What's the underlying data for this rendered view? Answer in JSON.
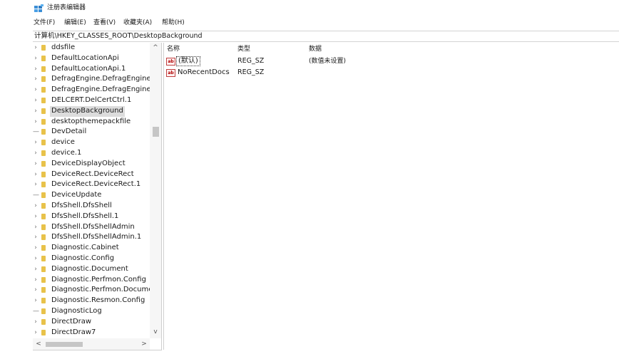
{
  "window": {
    "title": "注册表编辑器",
    "icon": "registry-editor-icon"
  },
  "menu": [
    "文件(F)",
    "编辑(E)",
    "查看(V)",
    "收藏夹(A)",
    "帮助(H)"
  ],
  "address": "计算机\\HKEY_CLASSES_ROOT\\DesktopBackground",
  "tree": {
    "items": [
      {
        "label": "ddsfile",
        "expandable": true
      },
      {
        "label": "DefaultLocationApi",
        "expandable": true
      },
      {
        "label": "DefaultLocationApi.1",
        "expandable": true
      },
      {
        "label": "DefragEngine.DefragEngine",
        "expandable": true
      },
      {
        "label": "DefragEngine.DefragEngine.",
        "expandable": true
      },
      {
        "label": "DELCERT.DelCertCtrl.1",
        "expandable": true
      },
      {
        "label": "DesktopBackground",
        "expandable": true,
        "selected": true
      },
      {
        "label": "desktopthemepackfile",
        "expandable": true
      },
      {
        "label": "DevDetail",
        "expandable": false
      },
      {
        "label": "device",
        "expandable": true
      },
      {
        "label": "device.1",
        "expandable": true
      },
      {
        "label": "DeviceDisplayObject",
        "expandable": true
      },
      {
        "label": "DeviceRect.DeviceRect",
        "expandable": true
      },
      {
        "label": "DeviceRect.DeviceRect.1",
        "expandable": true
      },
      {
        "label": "DeviceUpdate",
        "expandable": false
      },
      {
        "label": "DfsShell.DfsShell",
        "expandable": true
      },
      {
        "label": "DfsShell.DfsShell.1",
        "expandable": true
      },
      {
        "label": "DfsShell.DfsShellAdmin",
        "expandable": true
      },
      {
        "label": "DfsShell.DfsShellAdmin.1",
        "expandable": true
      },
      {
        "label": "Diagnostic.Cabinet",
        "expandable": true
      },
      {
        "label": "Diagnostic.Config",
        "expandable": true
      },
      {
        "label": "Diagnostic.Document",
        "expandable": true
      },
      {
        "label": "Diagnostic.Perfmon.Config",
        "expandable": true
      },
      {
        "label": "Diagnostic.Perfmon.Docume",
        "expandable": true
      },
      {
        "label": "Diagnostic.Resmon.Config",
        "expandable": true
      },
      {
        "label": "DiagnosticLog",
        "expandable": false
      },
      {
        "label": "DirectDraw",
        "expandable": true
      },
      {
        "label": "DirectDraw7",
        "expandable": true
      }
    ],
    "expander_glyph": "›",
    "leaf_glyph": "—"
  },
  "scrollbars": {
    "up": "^",
    "down": "v",
    "left": "<",
    "right": ">"
  },
  "values": {
    "headers": {
      "name": "名称",
      "type": "类型",
      "data": "数据"
    },
    "icon_text": "ab",
    "rows": [
      {
        "name": "(默认)",
        "type": "REG_SZ",
        "data": "(数值未设置)"
      },
      {
        "name": "NoRecentDocs",
        "type": "REG_SZ",
        "data": ""
      }
    ]
  }
}
